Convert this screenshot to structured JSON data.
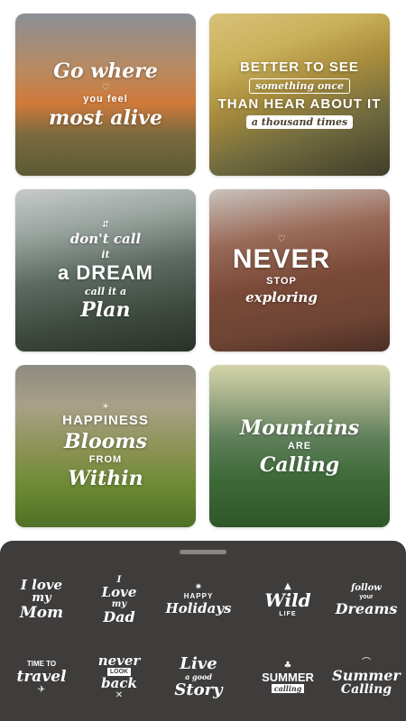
{
  "quote_cards": [
    {
      "lines": [
        "Go where",
        "you feel",
        "most alive"
      ]
    },
    {
      "lines": [
        "BETTER TO SEE",
        "something once",
        "THAN HEAR ABOUT IT",
        "a thousand times"
      ]
    },
    {
      "lines": [
        "don't call",
        "it",
        "a DREAM",
        "call it a",
        "Plan"
      ]
    },
    {
      "lines": [
        "NEVER",
        "STOP",
        "exploring"
      ]
    },
    {
      "lines": [
        "HAPPINESS",
        "Blooms",
        "FROM",
        "Within"
      ]
    },
    {
      "lines": [
        "Mountains",
        "ARE",
        "Calling"
      ]
    }
  ],
  "sticker_panel": {
    "stickers": [
      {
        "lines": [
          "I love",
          "my",
          "Mom"
        ]
      },
      {
        "lines": [
          "I",
          "Love",
          "my",
          "Dad"
        ]
      },
      {
        "lines": [
          "HAPPY",
          "Holidays"
        ]
      },
      {
        "lines": [
          "Wild",
          "LIFE"
        ]
      },
      {
        "lines": [
          "follow",
          "your",
          "Dreams"
        ]
      },
      {
        "lines": [
          "TIME TO",
          "travel"
        ]
      },
      {
        "lines": [
          "never",
          "LOOK",
          "back"
        ]
      },
      {
        "lines": [
          "Live",
          "a good",
          "Story"
        ]
      },
      {
        "lines": [
          "SUMMER",
          "calling"
        ]
      },
      {
        "lines": [
          "Summer",
          "Calling"
        ]
      }
    ]
  },
  "icons": {
    "heart": "heart-icon",
    "sun": "sun-icon",
    "mountain": "mountain-icon",
    "arrows": "arrows-icon",
    "palm": "palm-tree-icon",
    "dolphin": "dolphin-icon",
    "plane": "airplane-icon",
    "cross": "cross-icon"
  },
  "colors": {
    "panel_bg": "#3f3d3c",
    "handle": "#8a8785",
    "text_light": "#ffffff"
  }
}
